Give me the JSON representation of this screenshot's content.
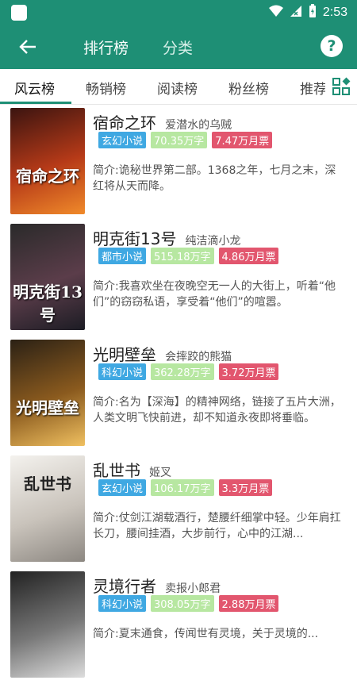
{
  "status_bar": {
    "time": "2:53"
  },
  "app_bar": {
    "tabs": [
      "排行榜",
      "分类"
    ],
    "help": "?"
  },
  "rank_tabs": [
    "风云榜",
    "畅销榜",
    "阅读榜",
    "粉丝榜",
    "推荐榜"
  ],
  "books": [
    {
      "title": "宿命之环",
      "author": "爱潜水的乌贼",
      "genre": "玄幻小说",
      "words": "70.35万字",
      "votes": "7.47万月票",
      "intro": "简介:诡秘世界第二部。1368之年，七月之末，深红将从天而降。",
      "cover_text": "宿命之环",
      "cover_colors": [
        "#3b1410",
        "#b63a18",
        "#f08a2a"
      ]
    },
    {
      "title": "明克街13号",
      "author": "纯洁滴小龙",
      "genre": "都市小说",
      "words": "515.18万字",
      "votes": "4.86万月票",
      "intro": "简介:我喜欢坐在夜晚空无一人的大街上，听着“他们”的窃窃私语，享受着“他们”的喧嚣。",
      "cover_text": "明克街13号",
      "cover_colors": [
        "#2a2a2a",
        "#5b3d4a",
        "#1c1c24"
      ]
    },
    {
      "title": "光明壁垒",
      "author": "会摔跤的熊猫",
      "genre": "科幻小说",
      "words": "362.28万字",
      "votes": "3.72万月票",
      "intro": "简介:名为【深海】的精神网络，链接了五片大洲，人类文明飞快前进，却不知道永夜即将垂临。",
      "cover_text": "光明壁垒",
      "cover_colors": [
        "#2b2115",
        "#8a5a1e",
        "#f0c060"
      ]
    },
    {
      "title": "乱世书",
      "author": "姬叉",
      "genre": "玄幻小说",
      "words": "106.17万字",
      "votes": "3.3万月票",
      "intro": "简介:仗剑江湖载酒行，楚腰纤细掌中轻。少年肩扛长刀，腰间挂酒，大步前行，心中的江湖...",
      "cover_text": "乱世书",
      "cover_colors": [
        "#f4f2ee",
        "#c9c3bb",
        "#8c8781"
      ]
    },
    {
      "title": "灵境行者",
      "author": "卖报小郎君",
      "genre": "科幻小说",
      "words": "308.05万字",
      "votes": "2.88万月票",
      "intro": "简介:夏末通食，传闻世有灵境，关于灵境的...",
      "cover_text": "",
      "cover_colors": [
        "#222",
        "#777",
        "#ddd"
      ]
    }
  ]
}
